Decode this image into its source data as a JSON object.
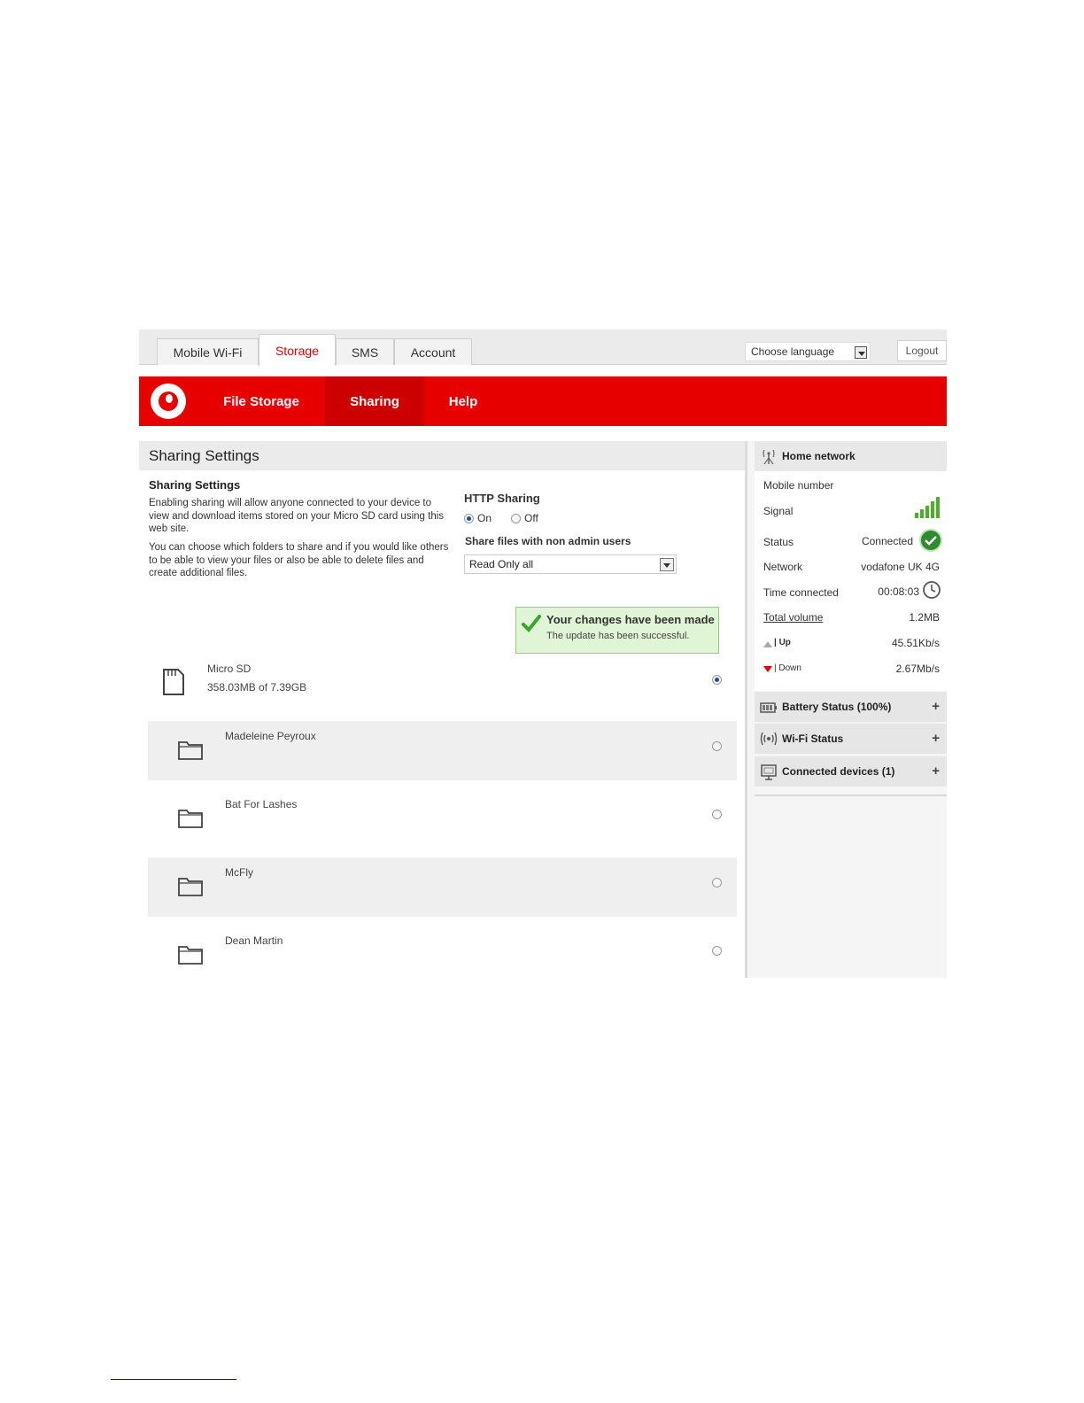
{
  "tabs": [
    {
      "label": "Mobile Wi-Fi",
      "active": false
    },
    {
      "label": "Storage",
      "active": true
    },
    {
      "label": "SMS",
      "active": false
    },
    {
      "label": "Account",
      "active": false
    }
  ],
  "language": {
    "value": "Choose language"
  },
  "logout_label": "Logout",
  "nav": [
    {
      "label": "File Storage",
      "active": false
    },
    {
      "label": "Sharing",
      "active": true
    },
    {
      "label": "Help",
      "active": false
    }
  ],
  "main": {
    "title": "Sharing Settings",
    "subtitle": "Sharing Settings",
    "desc1": "Enabling sharing will allow anyone connected to your device to view and download items stored on your Micro SD card using this web site.",
    "desc2": "You can choose which folders to share and if you would like others to be able to view your files or also be able to delete files and create additional files.",
    "http_sharing": {
      "label": "HTTP Sharing",
      "on_label": "On",
      "off_label": "Off",
      "selected": "On"
    },
    "share_files": {
      "label": "Share files with non admin users",
      "value": "Read Only all"
    },
    "success": {
      "title": "Your changes have been made",
      "message": "The update has been successful."
    },
    "storage": {
      "name": "Micro SD",
      "usage": "358.03MB of 7.39GB",
      "selected": true
    },
    "folders": [
      {
        "name": "Madeleine Peyroux",
        "selected": false
      },
      {
        "name": "Bat For Lashes",
        "selected": false
      },
      {
        "name": "McFly",
        "selected": false
      },
      {
        "name": "Dean Martin",
        "selected": false
      }
    ]
  },
  "sidebar": {
    "home_network": "Home network",
    "mobile_number_label": "Mobile number",
    "signal_label": "Signal",
    "signal_bars": 5,
    "status_label": "Status",
    "status_value": "Connected",
    "network_label": "Network",
    "network_value": "vodafone UK 4G",
    "time_label": "Time connected",
    "time_value": "00:08:03",
    "volume_label": "Total volume",
    "volume_value": "1.2MB",
    "up_label": "Up",
    "up_value": "45.51Kb/s",
    "down_label": "Down",
    "down_value": "2.67Mb/s",
    "panels": [
      {
        "label": "Battery Status (100%)",
        "icon": "battery-icon"
      },
      {
        "label": "Wi-Fi Status",
        "icon": "wifi-icon"
      },
      {
        "label": "Connected devices (1)",
        "icon": "monitor-icon"
      }
    ],
    "expand_symbol": "+"
  },
  "colors": {
    "brand_red": "#e60000",
    "active_nav": "#cc0000",
    "success_bg": "#dff5d6",
    "signal_green": "#4caf2a"
  }
}
